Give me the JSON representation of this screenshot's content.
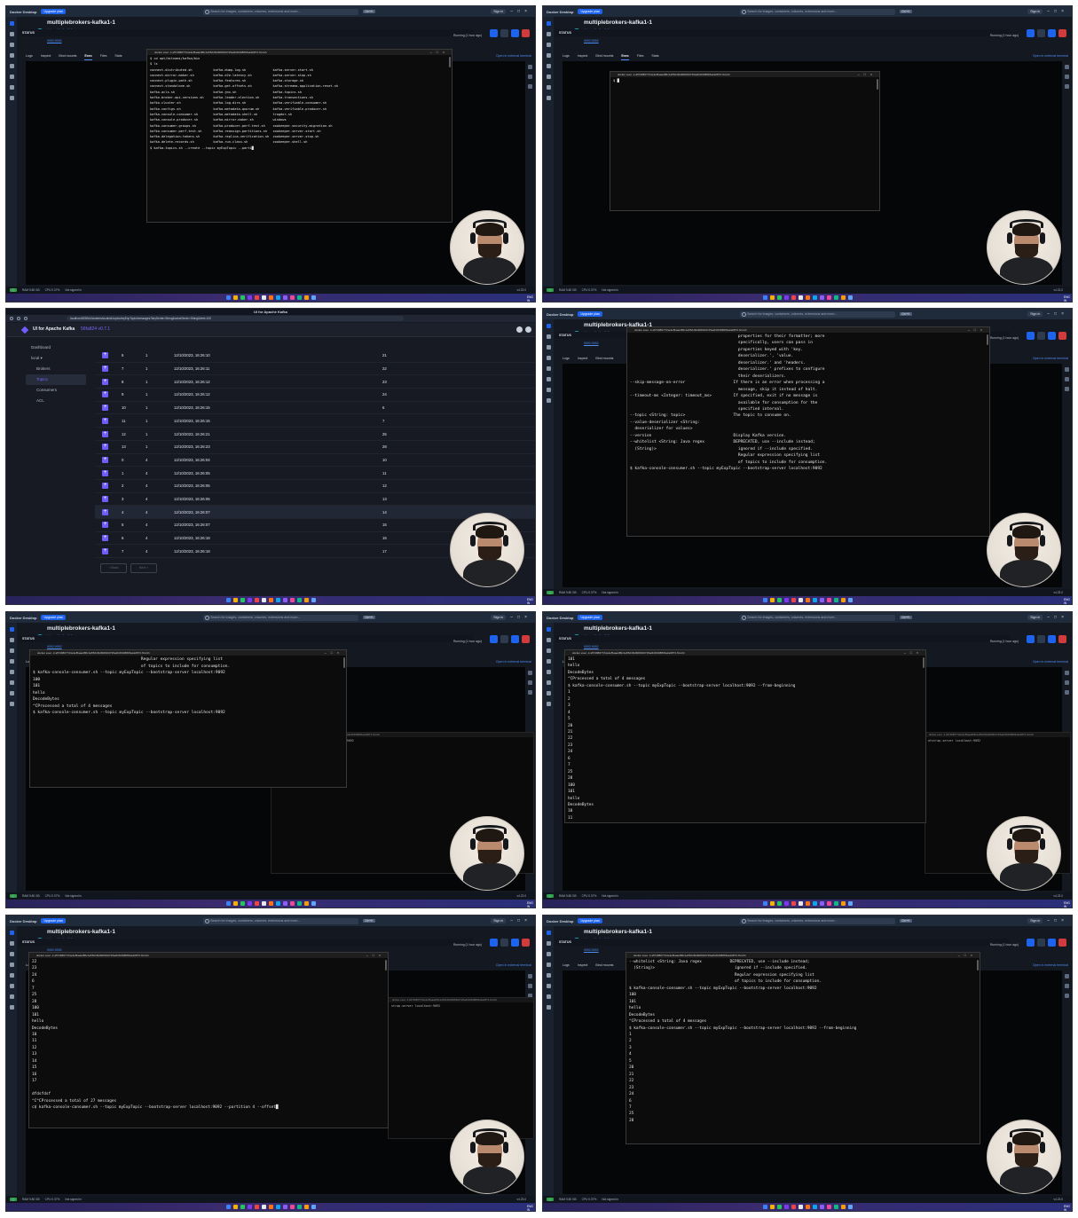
{
  "docker": {
    "app_name": "Docker Desktop",
    "upgrade_label": "Upgrade plan",
    "search_placeholder": "Search for images, containers, volumes, extensions and more...",
    "search_kbd": "Ctrl+K",
    "sign_in": "Sign in",
    "container_name": "multiplebrokers-kafka1-1",
    "image_link": "bitnami/kafka:3.6",
    "container_id": "a5749807724e",
    "port_link": "9092:9092",
    "status_label": "STATUS",
    "running_text": "Running (1 hour ago)",
    "tabs": [
      "Logs",
      "Inspect",
      "Bind mounts",
      "Exec",
      "Files",
      "Stats"
    ],
    "open_external": "Open in external terminal",
    "statusbar": {
      "ram": "RAM 5.80 GB",
      "cpu": "CPU 0.37%",
      "signed": "Not signed in",
      "version": "v4.23.0"
    },
    "taskbar_time": "ENG IN"
  },
  "term_title": "docker exec -it a5749807724e4ef5aaa486c1a5524f4d6084b0725adb303088b5a2a0873 /bin/sh",
  "term_title_sel": "Select docker exec -it a5749807724e4ef5aaa486c1a5524f4d6084b0725adb303088b5a2a0873 /bin/sh",
  "panel1_text": "$ cd opt/bitnami/kafka/bin\n$ ls\nconnect-distributed.sh           kafka-dump-log.sh              kafka-server-start.sh\nconnect-mirror-maker.sh          kafka-e2e-latency.sh           kafka-server-stop.sh\nconnect-plugin-path.sh           kafka-features.sh              kafka-storage.sh\nconnect-standalone.sh            kafka-get-offsets.sh           kafka-streams-application-reset.sh\nkafka-acls.sh                    kafka-jmx.sh                   kafka-topics.sh\nkafka-broker-api-versions.sh     kafka-leader-election.sh       kafka-transactions.sh\nkafka-cluster.sh                 kafka-log-dirs.sh              kafka-verifiable-consumer.sh\nkafka-configs.sh                 kafka-metadata-quorum.sh       kafka-verifiable-producer.sh\nkafka-console-consumer.sh        kafka-metadata-shell.sh        trogdor.sh\nkafka-console-producer.sh        kafka-mirror-maker.sh          windows\nkafka-consumer-groups.sh         kafka-producer-perf-test.sh    zookeeper-security-migration.sh\nkafka-consumer-perf-test.sh      kafka-reassign-partitions.sh   zookeeper-server-start.sh\nkafka-delegation-tokens.sh       kafka-replica-verification.sh  zookeeper-server-stop.sh\nkafka-delete-records.sh          kafka-run-class.sh             zookeeper-shell.sh\n$ kafka-topics.sh --create --topic myExpTopic --parti█",
  "panel2_text": "$ █",
  "kafka_ui": {
    "url": "localhost:8080/ui/clusters/local/all-topics/myExpTopic/messages?keySerde=String&valueSerde=String&limit=100",
    "tab_title": "UI for Apache Kafka",
    "app_title": "UI for Apache Kafka",
    "version": "56fa824 v0.7.1",
    "nav": [
      "Dashboard",
      "local ▾",
      "Brokers",
      "Topics",
      "Consumers",
      "ACL"
    ],
    "rows": [
      [
        "6",
        "1",
        "12/10/2023, 16:26:10",
        "21"
      ],
      [
        "7",
        "1",
        "12/10/2023, 16:26:11",
        "22"
      ],
      [
        "8",
        "1",
        "12/10/2023, 16:26:12",
        "23"
      ],
      [
        "9",
        "1",
        "12/10/2023, 16:26:12",
        "24"
      ],
      [
        "10",
        "1",
        "12/10/2023, 16:26:15",
        "6"
      ],
      [
        "11",
        "1",
        "12/10/2023, 16:26:15",
        "7"
      ],
      [
        "12",
        "1",
        "12/10/2023, 16:26:21",
        "25"
      ],
      [
        "13",
        "1",
        "12/10/2023, 16:26:23",
        "28"
      ],
      [
        "0",
        "4",
        "12/10/2023, 16:26:04",
        "10"
      ],
      [
        "1",
        "4",
        "12/10/2023, 16:26:05",
        "11"
      ],
      [
        "2",
        "4",
        "12/10/2023, 16:26:06",
        "12"
      ],
      [
        "3",
        "4",
        "12/10/2023, 16:26:06",
        "13"
      ],
      [
        "4",
        "4",
        "12/10/2023, 16:26:07",
        "14"
      ],
      [
        "5",
        "4",
        "12/10/2023, 16:26:07",
        "15"
      ],
      [
        "6",
        "4",
        "12/10/2023, 16:26:18",
        "16"
      ],
      [
        "7",
        "4",
        "12/10/2023, 16:26:18",
        "17"
      ]
    ],
    "back": "< Back",
    "next": "Next >"
  },
  "panel4_text": "                                             properties for their formatter; more\n                                             specifically, users can pass in\n                                             properties keyed with 'key.\n                                             deserializer.', 'value.\n                                             deserializer.' and 'headers.\n                                             deserializer.' prefixes to configure\n                                             their deserializers.\n--skip-message-on-error                    If there is an error when processing a\n                                             message, skip it instead of halt.\n--timeout-ms <Integer: timeout_ms>         If specified, exit if no message is\n                                             available for consumption for the\n                                             specified interval.\n--topic <String: topic>                    The topic to consume on.\n--value-deserializer <String:\n  deserializer for values>\n--version                                  Display Kafka version.\n--whitelist <String: Java regex            DEPRECATED, use --include instead;\n  (String)>                                  ignored if --include specified.\n                                             Regular expression specifying list\n                                             of topics to include for consumption.\n$ kafka-console-consumer.sh --topic myExpTopic --bootstrap-server localhost:9092",
  "panel5_text": "                                             Regular expression specifying list\n                                             of topics to include for consumption.\n$ kafka-console-consumer.sh --topic myExpTopic --bootstrap-server localhost:9092\n100\n101\nhello\nDecodeBytes\n^CProcessed a total of 4 messages\n$ kafka-console-consumer.sh --topic myExpTopic --bootstrap-server localhost:9092",
  "panel5_bg_text": "myExpTopic --bootstrap-server localhost:9092",
  "panel6_text": "101\nhello\nDecodeBytes\n^CProcessed a total of 4 messages\n$ kafka-console-consumer.sh --topic myExpTopic --bootstrap-server localhost:9092 --from-beginning\n1\n2\n3\n4\n5\n20\n21\n22\n23\n24\n6\n7\n25\n28\n100\n101\nhello\nDecodeBytes\n10\n11",
  "panel6_bg_text": "otstrap-server localhost:9092",
  "panel7_text": "22\n23\n24\n6\n7\n25\n28\n100\n101\nhello\nDecodeBytes\n10\n11\n12\n13\n14\n15\n16\n17\n\ndfdsfdsf\n^C^CProcessed a total of 27 messages\nc$ kafka-console-consumer.sh --topic myExpTopic --bootstrap-server localhost:9092 --partition 4 --offset█",
  "panel7_bg_text": "strap-server localhost:9092",
  "panel8_text": "--whitelist <String: Java regex            DEPRECATED, use --include instead;\n  (String)>                                  ignored if --include specified.\n                                             Regular expression specifying list\n                                             of topics to include for consumption.\n$ kafka-console-consumer.sh --topic myExpTopic --bootstrap-server localhost:9092\n100\n101\nhello\nDecodeBytes\n^CProcessed a total of 4 messages\n$ kafka-console-consumer.sh --topic myExpTopic --bootstrap-server localhost:9092 --from-beginning\n1\n2\n3\n4\n5\n20\n21\n22\n23\n24\n6\n7\n25\n28"
}
